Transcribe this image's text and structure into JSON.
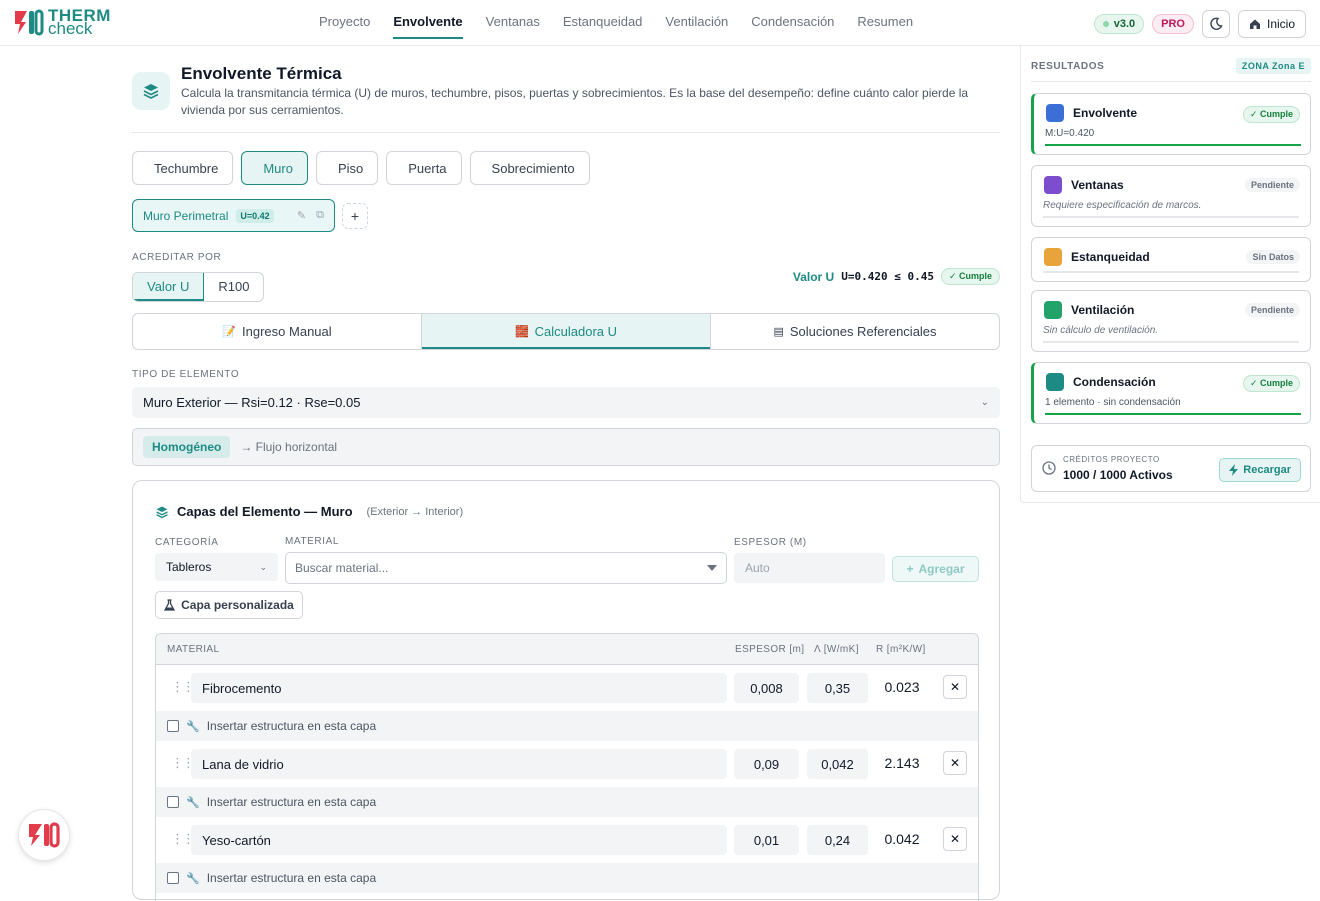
{
  "app": {
    "logo_line1": "THERM",
    "logo_line2": "check"
  },
  "nav": [
    "Proyecto",
    "Envolvente",
    "Ventanas",
    "Estanqueidad",
    "Ventilación",
    "Condensación",
    "Resumen"
  ],
  "nav_active": "Envolvente",
  "topbar": {
    "version": "v3.0",
    "plan": "PRO",
    "home_label": "Inicio"
  },
  "header": {
    "title": "Envolvente Térmica",
    "description": "Calcula la transmitancia térmica (U) de muros, techumbre, pisos, puertas y sobrecimientos. Es la base del desempeño: define cuánto calor pierde la vivienda por sus cerramientos."
  },
  "element_types": [
    {
      "label": "Techumbre",
      "icon": "house-icon"
    },
    {
      "label": "Muro",
      "icon": "square-icon"
    },
    {
      "label": "Piso",
      "icon": "floor-icon"
    },
    {
      "label": "Puerta",
      "icon": "door-icon"
    },
    {
      "label": "Sobrecimiento",
      "icon": "foundation-icon"
    }
  ],
  "element_types_active": "Muro",
  "element_chip": {
    "name": "Muro Perimetral",
    "u": "U=0.42"
  },
  "acreditar": {
    "label": "ACREDITAR POR",
    "options": [
      "Valor U",
      "R100"
    ],
    "active": "Valor U"
  },
  "u_status": {
    "label": "Valor U",
    "formula": "U=0.420 ≤ 0.45",
    "badge": "✓ Cumple"
  },
  "method_tabs": [
    {
      "label": "Ingreso Manual",
      "icon": "memo-icon"
    },
    {
      "label": "Calculadora U",
      "icon": "brick-icon"
    },
    {
      "label": "Soluciones Referenciales",
      "icon": "book-icon"
    }
  ],
  "method_active": "Calculadora U",
  "tipo": {
    "label": "TIPO DE ELEMENTO",
    "value": "Muro Exterior — Rsi=0.12 · Rse=0.05"
  },
  "homog": {
    "tag": "Homogéneo",
    "flow": "→ Flujo horizontal"
  },
  "capas": {
    "title": "Capas del Elemento — Muro",
    "subtitle": "(Exterior → Interior)",
    "categoria_label": "CATEGORÍA",
    "categoria_value": "Tableros",
    "material_label": "MATERIAL",
    "material_placeholder": "Buscar material...",
    "espesor_label": "ESPESOR (M)",
    "espesor_placeholder": "Auto",
    "add_label": "Agregar",
    "custom_label": "Capa personalizada",
    "columns": {
      "material": "MATERIAL",
      "espesor": "ESPESOR [m]",
      "lambda": "Λ [W/mK]",
      "r": "R [m²K/W]"
    },
    "insert_label": "Insertar estructura en esta capa",
    "layers": [
      {
        "name": "Fibrocemento",
        "espesor": "0,008",
        "lambda": "0,35",
        "r": "0.023"
      },
      {
        "name": "Lana de vidrio",
        "espesor": "0,09",
        "lambda": "0,042",
        "r": "2.143"
      },
      {
        "name": "Yeso-cartón",
        "espesor": "0,01",
        "lambda": "0,24",
        "r": "0.042"
      }
    ]
  },
  "results": {
    "title": "RESULTADOS",
    "zona": "ZONA Zona E",
    "cards": [
      {
        "name": "Envolvente",
        "status": "✓ Cumple",
        "sub": "M:U=0.420",
        "ok": true,
        "color": "#3b6fd6"
      },
      {
        "name": "Ventanas",
        "status": "Pendiente",
        "sub": "Requiere especificación de marcos.",
        "ok": false,
        "color": "#7c4dcc"
      },
      {
        "name": "Estanqueidad",
        "status": "Sin Datos",
        "sub": "",
        "ok": false,
        "color": "#e8a33a"
      },
      {
        "name": "Ventilación",
        "status": "Pendiente",
        "sub": "Sin cálculo de ventilación.",
        "ok": false,
        "color": "#22a36a"
      },
      {
        "name": "Condensación",
        "status": "✓ Cumple",
        "sub": "1 elemento · sin condensación",
        "ok": true,
        "color": "#1e8a84"
      }
    ],
    "credits_label": "CRÉDITOS PROYECTO",
    "credits_value": "1000 / 1000 Activos",
    "recargar": "Recargar"
  },
  "colors": {
    "accent": "#1e8a84",
    "brand_red": "#e23b4a",
    "ok": "#16a34a"
  }
}
